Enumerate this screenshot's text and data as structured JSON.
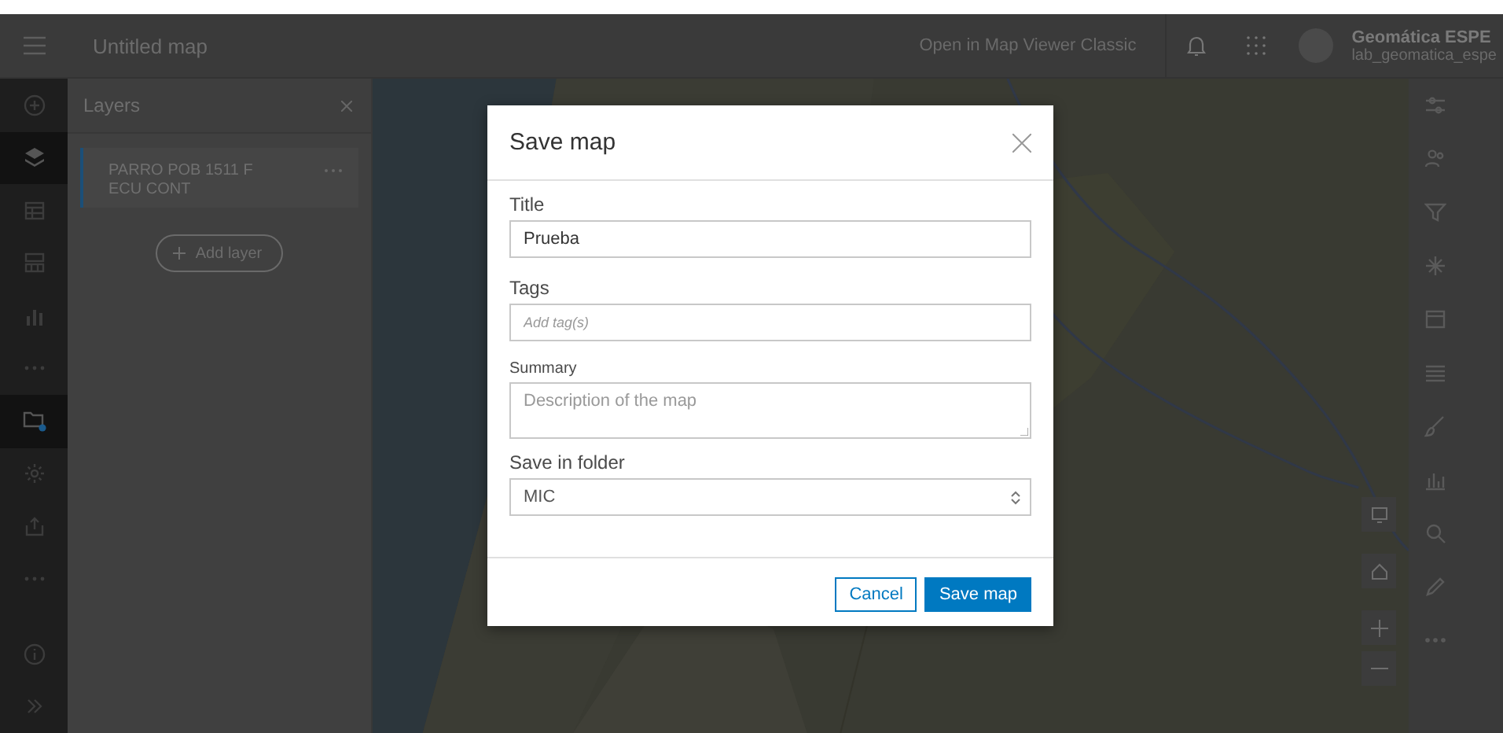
{
  "header": {
    "title": "Untitled map",
    "link": "Open in Map Viewer Classic",
    "user": {
      "name": "Geomática ESPE",
      "username": "lab_geomatica_espe"
    }
  },
  "left_rail": [
    {
      "kind": "add",
      "selected": false
    },
    {
      "kind": "layers",
      "selected": true
    },
    {
      "kind": "table",
      "selected": false
    },
    {
      "kind": "grid",
      "selected": false
    },
    {
      "kind": "chart",
      "selected": false
    },
    {
      "kind": "more",
      "selected": false
    },
    {
      "kind": "folder",
      "selected": true
    },
    {
      "kind": "gear",
      "selected": false
    },
    {
      "kind": "share",
      "selected": false
    },
    {
      "kind": "more",
      "selected": false
    },
    {
      "kind": "info",
      "selected": false
    },
    {
      "kind": "expand",
      "selected": false
    }
  ],
  "layers_panel": {
    "title": "Layers",
    "layers": [
      {
        "name": "PARRO POB 1511 F ECU CONT",
        "selected": true
      }
    ],
    "add_button": "Add layer"
  },
  "dialog": {
    "title": "Save map",
    "fields": [
      {
        "label": "Title",
        "kind": "text",
        "value": "Prueba"
      },
      {
        "label": "Tags",
        "kind": "tags",
        "placeholder": "Add tag(s)"
      },
      {
        "label": "Summary",
        "kind": "textarea",
        "placeholder": "Description of the map"
      },
      {
        "label": "Save in folder",
        "kind": "select",
        "value": "MIC"
      }
    ],
    "buttons": [
      {
        "label": "Cancel",
        "kind": "secondary"
      },
      {
        "label": "Save map",
        "kind": "primary"
      }
    ]
  }
}
